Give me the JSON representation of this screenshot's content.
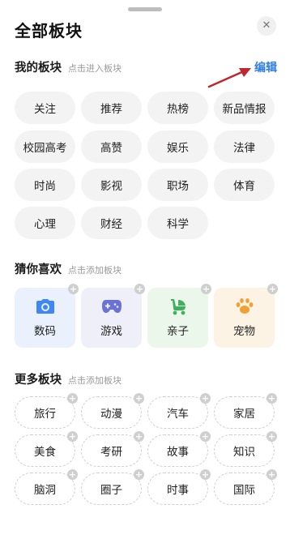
{
  "header": {
    "title": "全部板块",
    "close_glyph": "✕"
  },
  "my_section": {
    "title": "我的板块",
    "hint": "点击进入板块",
    "edit_label": "编辑",
    "items": [
      "关注",
      "推荐",
      "热榜",
      "新品情报",
      "校园高考",
      "高赞",
      "娱乐",
      "法律",
      "时尚",
      "影视",
      "职场",
      "体育",
      "心理",
      "财经",
      "科学"
    ]
  },
  "guess_section": {
    "title": "猜你喜欢",
    "hint": "点击添加板块",
    "items": [
      {
        "label": "数码",
        "icon": "camera-icon",
        "bg": "#eaf1fd",
        "color": "#3f87f5"
      },
      {
        "label": "游戏",
        "icon": "gamepad-icon",
        "bg": "#eeeff9",
        "color": "#6b72d6"
      },
      {
        "label": "亲子",
        "icon": "stroller-icon",
        "bg": "#ecf7ec",
        "color": "#3fb15c"
      },
      {
        "label": "宠物",
        "icon": "paw-icon",
        "bg": "#fdf3e4",
        "color": "#f1a032"
      }
    ]
  },
  "more_section": {
    "title": "更多板块",
    "hint": "点击添加板块",
    "items": [
      "旅行",
      "动漫",
      "汽车",
      "家居",
      "美食",
      "考研",
      "故事",
      "知识",
      "脑洞",
      "圈子",
      "时事",
      "国际"
    ]
  },
  "colors": {
    "accent": "#2f7de8",
    "arrow": "#c0262c"
  }
}
